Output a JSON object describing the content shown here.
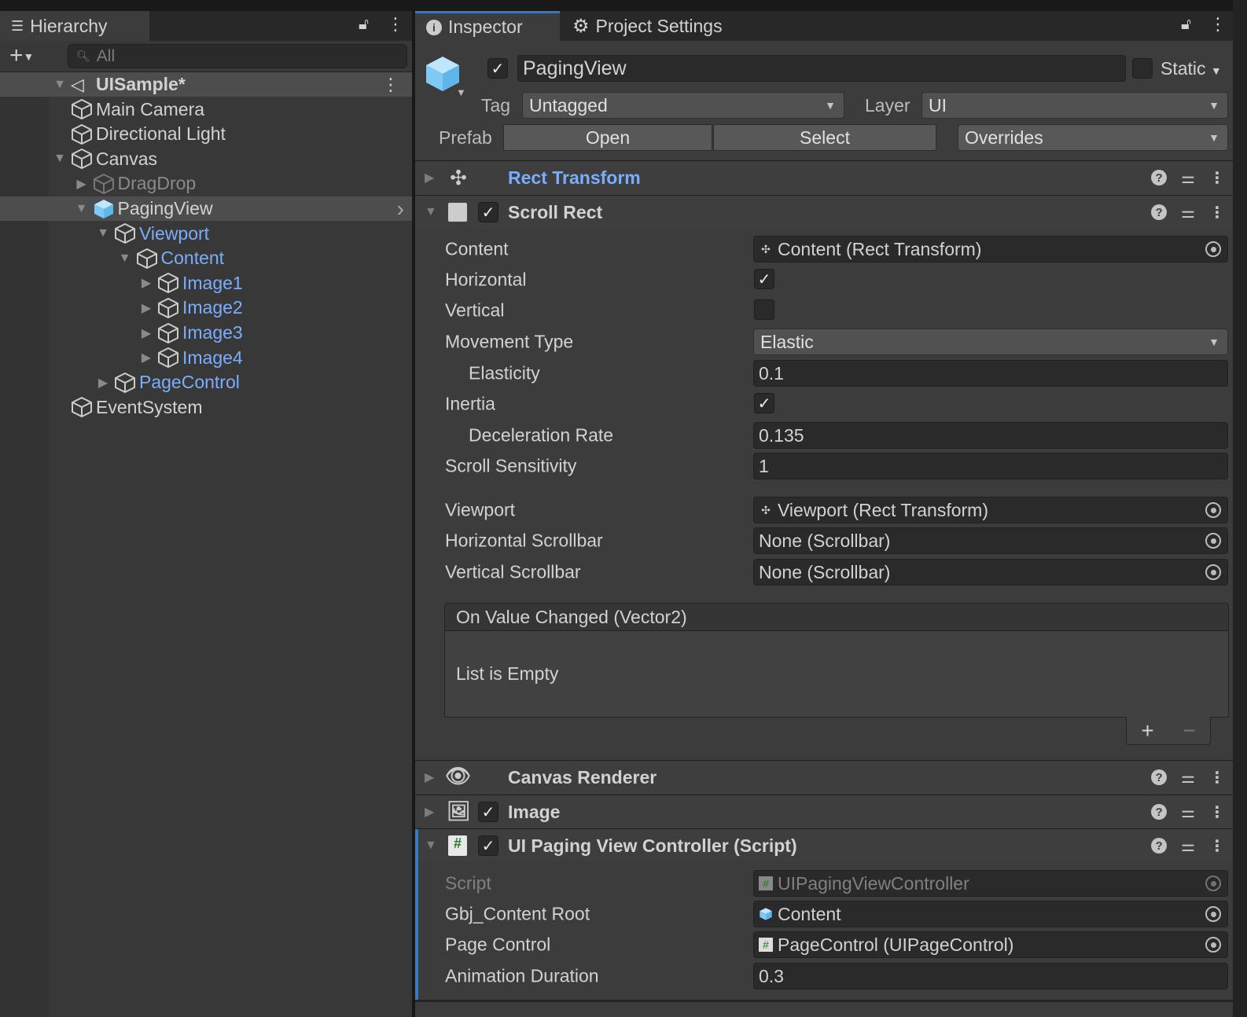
{
  "hierarchy": {
    "tab_label": "Hierarchy",
    "search_placeholder": "All",
    "items": [
      {
        "label": "UISample*",
        "depth": 0,
        "expanded": true,
        "scene": true,
        "selected_row": true
      },
      {
        "label": "Main Camera",
        "depth": 1
      },
      {
        "label": "Directional Light",
        "depth": 1
      },
      {
        "label": "Canvas",
        "depth": 1,
        "expanded": true
      },
      {
        "label": "DragDrop",
        "depth": 2,
        "collapsed": true,
        "inactive": true
      },
      {
        "label": "PagingView",
        "depth": 2,
        "expanded": true,
        "prefab": true,
        "selected": true
      },
      {
        "label": "Viewport",
        "depth": 3,
        "expanded": true,
        "prefab_child": true
      },
      {
        "label": "Content",
        "depth": 4,
        "expanded": true,
        "prefab_child": true
      },
      {
        "label": "Image1",
        "depth": 5,
        "collapsed": true,
        "prefab_child": true
      },
      {
        "label": "Image2",
        "depth": 5,
        "collapsed": true,
        "prefab_child": true
      },
      {
        "label": "Image3",
        "depth": 5,
        "collapsed": true,
        "prefab_child": true
      },
      {
        "label": "Image4",
        "depth": 5,
        "collapsed": true,
        "prefab_child": true
      },
      {
        "label": "PageControl",
        "depth": 3,
        "collapsed": true,
        "prefab_child": true
      },
      {
        "label": "EventSystem",
        "depth": 1
      }
    ]
  },
  "inspector": {
    "tab_label": "Inspector",
    "project_settings_tab": "Project Settings",
    "object_name": "PagingView",
    "active": true,
    "static_label": "Static",
    "tag_label": "Tag",
    "tag_value": "Untagged",
    "layer_label": "Layer",
    "layer_value": "UI",
    "prefab_label": "Prefab",
    "open_label": "Open",
    "select_label": "Select",
    "overrides_label": "Overrides",
    "components": {
      "rect_transform": "Rect Transform",
      "scroll_rect": "Scroll Rect",
      "canvas_renderer": "Canvas Renderer",
      "image": "Image",
      "paging_controller": "UI Paging View Controller (Script)"
    },
    "scroll_rect_props": [
      {
        "label": "Content",
        "type": "object",
        "value": "Content (Rect Transform)",
        "icon": "rect-transform"
      },
      {
        "label": "Horizontal",
        "type": "checkbox",
        "checked": true
      },
      {
        "label": "Vertical",
        "type": "checkbox",
        "checked": false
      },
      {
        "label": "Movement Type",
        "type": "dropdown",
        "value": "Elastic"
      },
      {
        "label": "Elasticity",
        "type": "text",
        "value": "0.1",
        "indent": true
      },
      {
        "label": "Inertia",
        "type": "checkbox",
        "checked": true
      },
      {
        "label": "Deceleration Rate",
        "type": "text",
        "value": "0.135",
        "indent": true
      },
      {
        "label": "Scroll Sensitivity",
        "type": "text",
        "value": "1"
      },
      {
        "label": "Viewport",
        "type": "object",
        "value": "Viewport (Rect Transform)",
        "icon": "rect-transform"
      },
      {
        "label": "Horizontal Scrollbar",
        "type": "object",
        "value": "None (Scrollbar)"
      },
      {
        "label": "Vertical Scrollbar",
        "type": "object",
        "value": "None (Scrollbar)"
      }
    ],
    "event": {
      "header": "On Value Changed (Vector2)",
      "empty": "List is Empty",
      "add": "+",
      "remove": "−"
    },
    "script_props": [
      {
        "label": "Script",
        "type": "object",
        "value": "UIPagingViewController",
        "icon": "script",
        "disabled": true
      },
      {
        "label": "Gbj_Content Root",
        "type": "object",
        "value": "Content",
        "icon": "gameobject"
      },
      {
        "label": "Page Control",
        "type": "object",
        "value": "PageControl (UIPageControl)",
        "icon": "script"
      },
      {
        "label": "Animation Duration",
        "type": "text",
        "value": "0.3"
      }
    ]
  }
}
